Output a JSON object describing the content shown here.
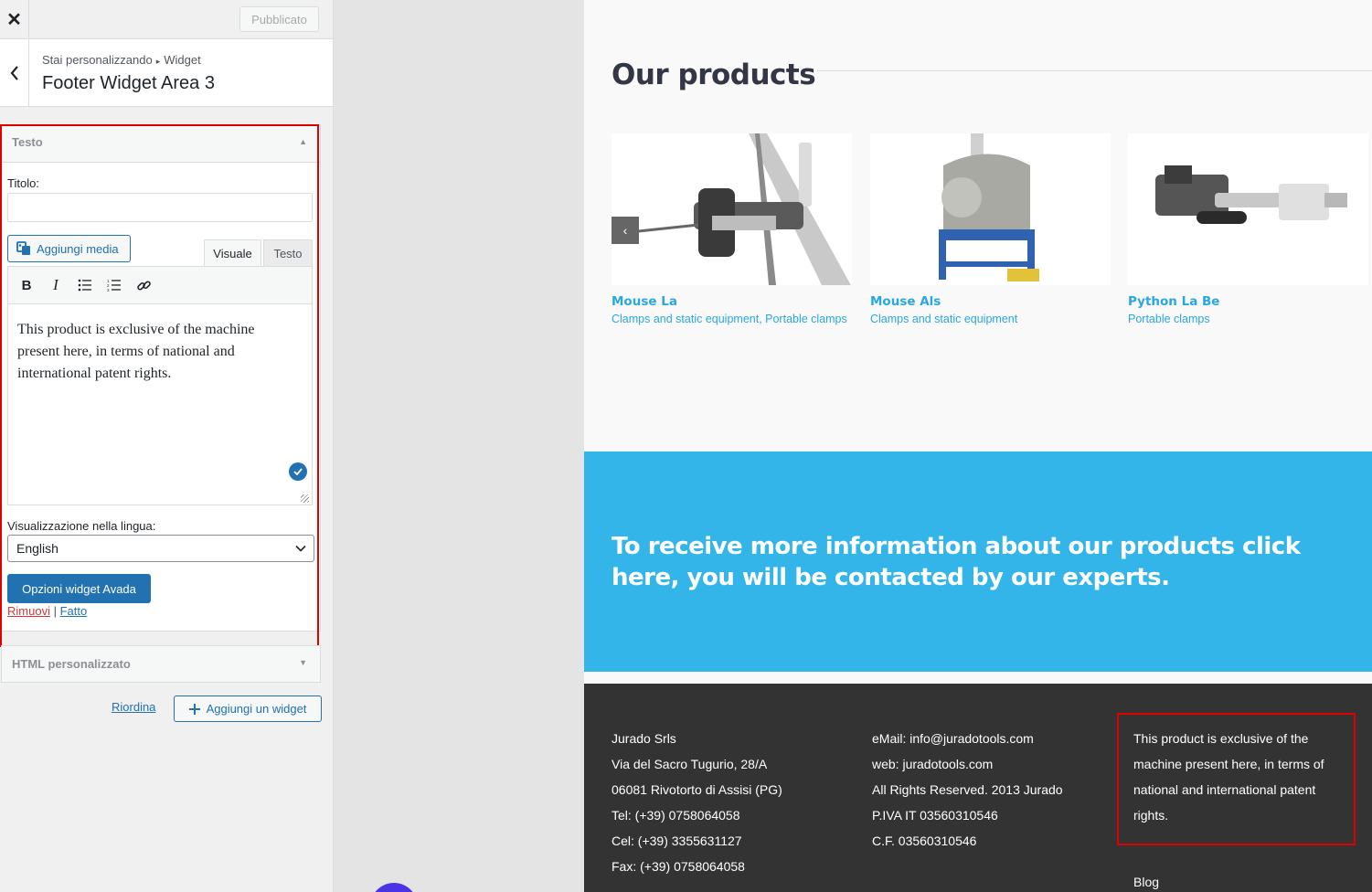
{
  "customizer": {
    "close_icon": "close-icon",
    "published_label": "Pubblicato",
    "breadcrumb": {
      "parent": "Stai personalizzando",
      "separator": "▸",
      "current": "Widget"
    },
    "section_title": "Footer Widget Area 3",
    "widget_text": {
      "header": "Testo",
      "title_label": "Titolo:",
      "title_value": "",
      "add_media_label": "Aggiungi media",
      "tab_visual": "Visuale",
      "tab_text": "Testo",
      "toolbar": [
        "bold-icon",
        "italic-icon",
        "bullet-list-icon",
        "numbered-list-icon",
        "link-icon"
      ],
      "content": "This product is exclusive of the machine present here, in terms of national and international patent rights.",
      "language_label": "Visualizzazione nella lingua:",
      "language_value": "English",
      "avada_button": "Opzioni widget Avada",
      "remove_link": "Rimuovi",
      "links_separator": "|",
      "done_link": "Fatto"
    },
    "widget_html": {
      "header": "HTML personalizzato"
    },
    "reorder_link": "Riordina",
    "add_widget_label": "Aggiungi un widget"
  },
  "preview": {
    "products_title": "Our products",
    "prev_arrow": "‹",
    "products": [
      {
        "name": "Mouse La",
        "categories": "Clamps and static equipment, Portable clamps"
      },
      {
        "name": "Mouse Als",
        "categories": "Clamps and static equipment"
      },
      {
        "name": "Python La Be",
        "categories": "Portable clamps"
      }
    ],
    "cta_text": "To receive more information about our products click here, you will be contacted by our experts.",
    "footer": {
      "col1": [
        "Jurado Srls",
        "Via del Sacro Tugurio, 28/A",
        "06081 Rivotorto di Assisi (PG)",
        "Tel: (+39) 0758064058",
        "Cel: (+39) 3355631127",
        "Fax: (+39) 0758064058"
      ],
      "col2": [
        "eMail: info@juradotools.com",
        "web: juradotools.com",
        "All Rights Reserved. 2013 Jurado",
        "P.IVA IT 03560310546",
        "C.F. 03560310546"
      ],
      "col3_text": "This product is exclusive of the machine present here, in terms of national and international patent rights.",
      "blog_link": "Blog"
    }
  },
  "colors": {
    "accent": "#2271b1",
    "link_blue": "#2aa7e0",
    "cta_bg": "#34b5ea",
    "footer_bg": "#333333",
    "highlight": "#e00000"
  }
}
